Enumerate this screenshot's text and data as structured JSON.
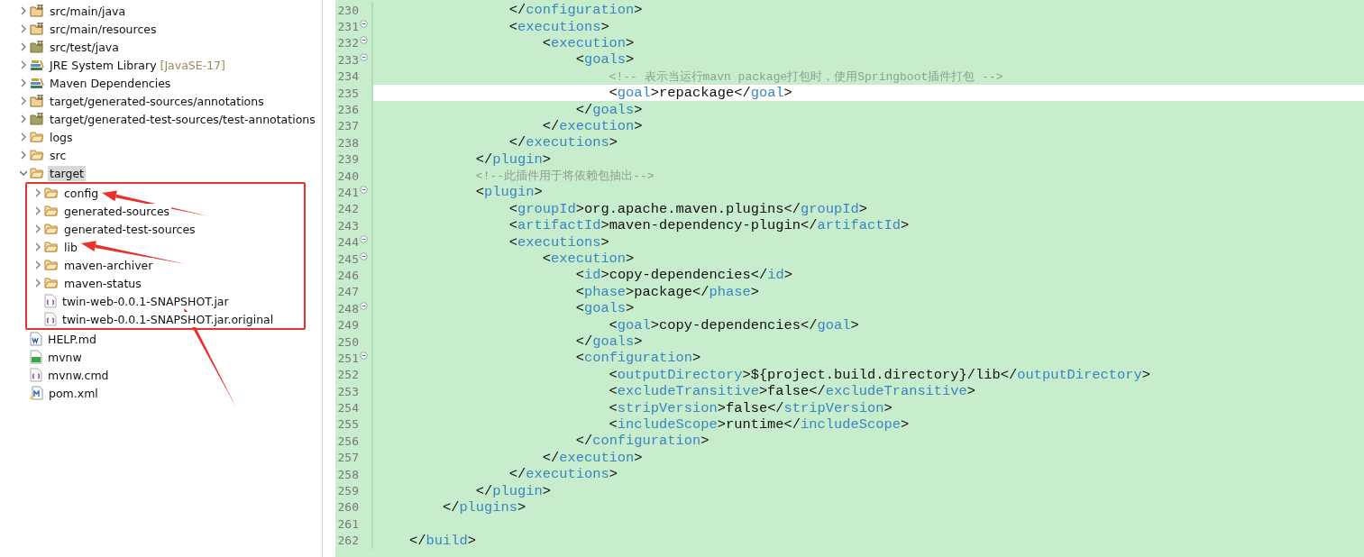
{
  "tree": {
    "items": [
      {
        "label": "src/main/java",
        "kind": "source",
        "expanded": false,
        "selected": false
      },
      {
        "label": "src/main/resources",
        "kind": "source",
        "expanded": false,
        "selected": false
      },
      {
        "label": "src/test/java",
        "kind": "testsource",
        "expanded": false,
        "selected": false
      },
      {
        "label": "JRE System Library",
        "decoration": "[JavaSE-17]",
        "kind": "library",
        "expanded": false,
        "selected": false
      },
      {
        "label": "Maven Dependencies",
        "kind": "library",
        "expanded": false,
        "selected": false
      },
      {
        "label": "target/generated-sources/annotations",
        "kind": "source",
        "expanded": false,
        "selected": false
      },
      {
        "label": "target/generated-test-sources/test-annotations",
        "kind": "testsource",
        "expanded": false,
        "selected": false
      },
      {
        "label": "logs",
        "kind": "folder",
        "expanded": false,
        "selected": false
      },
      {
        "label": "src",
        "kind": "folder",
        "expanded": false,
        "selected": false
      },
      {
        "label": "target",
        "kind": "folder",
        "expanded": true,
        "selected": true,
        "highlighted": true,
        "children": [
          {
            "label": "config",
            "kind": "folder",
            "expanded": false,
            "selected": false
          },
          {
            "label": "generated-sources",
            "kind": "folder",
            "expanded": false,
            "selected": false
          },
          {
            "label": "generated-test-sources",
            "kind": "folder",
            "expanded": false,
            "selected": false
          },
          {
            "label": "lib",
            "kind": "folder",
            "expanded": false,
            "selected": false
          },
          {
            "label": "maven-archiver",
            "kind": "folder",
            "expanded": false,
            "selected": false
          },
          {
            "label": "maven-status",
            "kind": "folder",
            "expanded": false,
            "selected": false
          },
          {
            "label": "twin-web-0.0.1-SNAPSHOT.jar",
            "kind": "braces",
            "selected": false
          },
          {
            "label": "twin-web-0.0.1-SNAPSHOT.jar.original",
            "kind": "braces",
            "selected": false
          }
        ]
      },
      {
        "label": "HELP.md",
        "kind": "doc",
        "selected": false
      },
      {
        "label": "mvnw",
        "kind": "shell",
        "selected": false
      },
      {
        "label": "mvnw.cmd",
        "kind": "braces",
        "selected": false
      },
      {
        "label": "pom.xml",
        "kind": "maven",
        "selected": false
      }
    ]
  },
  "editor": {
    "lines": [
      {
        "number": "230",
        "fold": false,
        "current": false,
        "code": "                </configuration>"
      },
      {
        "number": "231",
        "fold": true,
        "current": false,
        "code": "                <executions>"
      },
      {
        "number": "232",
        "fold": true,
        "current": false,
        "code": "                    <execution>"
      },
      {
        "number": "233",
        "fold": true,
        "current": false,
        "code": "                        <goals>"
      },
      {
        "number": "234",
        "fold": false,
        "current": false,
        "code": "                            <!-- 表示当运行mavn package打包时，使用Springboot插件打包 -->"
      },
      {
        "number": "235",
        "fold": false,
        "current": true,
        "code": "                            <goal>repackage</goal>"
      },
      {
        "number": "236",
        "fold": false,
        "current": false,
        "code": "                        </goals>"
      },
      {
        "number": "237",
        "fold": false,
        "current": false,
        "code": "                    </execution>"
      },
      {
        "number": "238",
        "fold": false,
        "current": false,
        "code": "                </executions>"
      },
      {
        "number": "239",
        "fold": false,
        "current": false,
        "code": "            </plugin>"
      },
      {
        "number": "240",
        "fold": false,
        "current": false,
        "code": "            <!--此插件用于将依赖包抽出-->"
      },
      {
        "number": "241",
        "fold": true,
        "current": false,
        "code": "            <plugin>"
      },
      {
        "number": "242",
        "fold": false,
        "current": false,
        "code": "                <groupId>org.apache.maven.plugins</groupId>"
      },
      {
        "number": "243",
        "fold": false,
        "current": false,
        "code": "                <artifactId>maven-dependency-plugin</artifactId>"
      },
      {
        "number": "244",
        "fold": true,
        "current": false,
        "code": "                <executions>"
      },
      {
        "number": "245",
        "fold": true,
        "current": false,
        "code": "                    <execution>"
      },
      {
        "number": "246",
        "fold": false,
        "current": false,
        "code": "                        <id>copy-dependencies</id>"
      },
      {
        "number": "247",
        "fold": false,
        "current": false,
        "code": "                        <phase>package</phase>"
      },
      {
        "number": "248",
        "fold": true,
        "current": false,
        "code": "                        <goals>"
      },
      {
        "number": "249",
        "fold": false,
        "current": false,
        "code": "                            <goal>copy-dependencies</goal>"
      },
      {
        "number": "250",
        "fold": false,
        "current": false,
        "code": "                        </goals>"
      },
      {
        "number": "251",
        "fold": true,
        "current": false,
        "code": "                        <configuration>"
      },
      {
        "number": "252",
        "fold": false,
        "current": false,
        "code": "                            <outputDirectory>${project.build.directory}/lib</outputDirectory>"
      },
      {
        "number": "253",
        "fold": false,
        "current": false,
        "code": "                            <excludeTransitive>false</excludeTransitive>"
      },
      {
        "number": "254",
        "fold": false,
        "current": false,
        "code": "                            <stripVersion>false</stripVersion>"
      },
      {
        "number": "255",
        "fold": false,
        "current": false,
        "code": "                            <includeScope>runtime</includeScope>"
      },
      {
        "number": "256",
        "fold": false,
        "current": false,
        "code": "                        </configuration>"
      },
      {
        "number": "257",
        "fold": false,
        "current": false,
        "code": "                    </execution>"
      },
      {
        "number": "258",
        "fold": false,
        "current": false,
        "code": "                </executions>"
      },
      {
        "number": "259",
        "fold": false,
        "current": false,
        "code": "            </plugin>"
      },
      {
        "number": "260",
        "fold": false,
        "current": false,
        "code": "        </plugins>"
      },
      {
        "number": "261",
        "fold": false,
        "current": false
      },
      {
        "number": "262",
        "fold": false,
        "current": false,
        "code": "    </build>"
      }
    ]
  }
}
